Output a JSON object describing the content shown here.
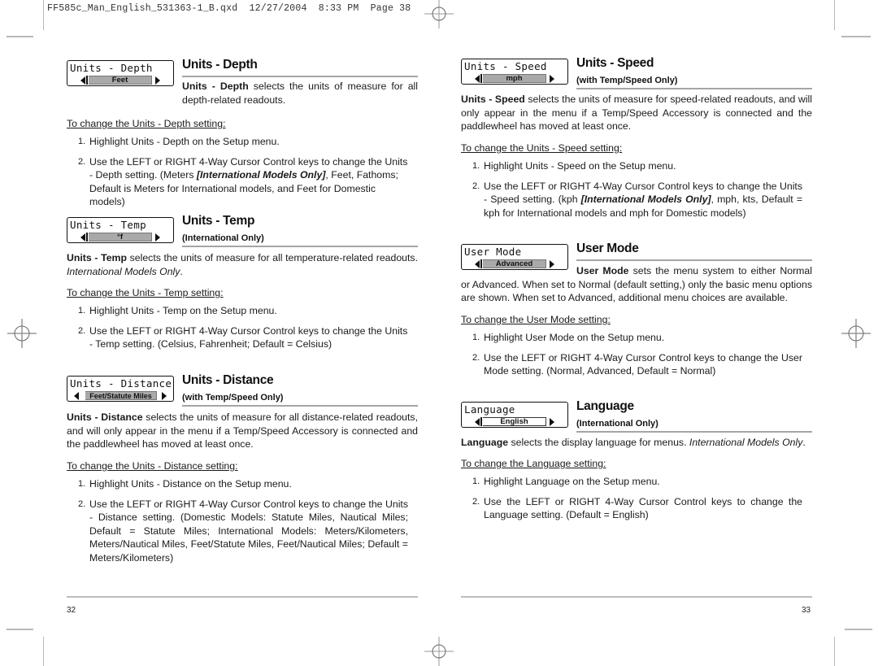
{
  "slug_line": "FF585c_Man_English_531363-1_B.qxd  12/27/2004  8:33 PM  Page 38",
  "left_page": {
    "page_number": "32",
    "sections": [
      {
        "id": "units-depth",
        "menu_title": "Units - Depth",
        "menu_value": "Feet",
        "heading": "Units - Depth",
        "subheading": "",
        "desc_bold": "Units - Depth",
        "desc_rest": " selects the units of measure for all depth-related readouts.",
        "change_label": "To change the Units - Depth setting:",
        "steps": [
          {
            "num": "1.",
            "text": "Highlight Units - Depth on the Setup menu."
          },
          {
            "num": "2.",
            "pre": "Use the LEFT or RIGHT 4-Way Cursor Control keys to change the Units - Depth setting. (Meters ",
            "em": "[International Models Only]",
            "post": ", Feet, Fathoms; Default is Meters for International models, and Feet for Domestic models)"
          }
        ]
      },
      {
        "id": "units-temp",
        "menu_title": "Units - Temp",
        "menu_value": "°f",
        "heading": "Units - Temp",
        "subheading": "(International Only)",
        "desc_bold": "Units - Temp",
        "desc_rest": " selects the units of measure for all temperature-related readouts. ",
        "desc_italic": "International Models Only",
        "desc_end": ".",
        "change_label": "To change the Units - Temp setting:",
        "steps": [
          {
            "num": "1.",
            "text": "Highlight Units - Temp on the Setup menu."
          },
          {
            "num": "2.",
            "text": "Use the LEFT or RIGHT 4-Way Cursor Control keys to change the Units - Temp setting. (Celsius, Fahrenheit; Default = Celsius)"
          }
        ]
      },
      {
        "id": "units-distance",
        "menu_title": "Units - Distance",
        "menu_value": "Feet/Statute Miles",
        "heading": "Units - Distance",
        "subheading": "(with Temp/Speed Only)",
        "desc_bold": "Units - Distance",
        "desc_rest": " selects the units of measure for all distance-related readouts, and will only appear in the menu if a Temp/Speed Accessory is connected and the paddlewheel has moved at least once.",
        "change_label": "To change the Units - Distance setting:",
        "steps": [
          {
            "num": "1.",
            "text": "Highlight Units - Distance on the Setup menu."
          },
          {
            "num": "2.",
            "text": "Use the LEFT or RIGHT 4-Way Cursor Control keys to change the Units - Distance setting. (Domestic Models: Statute Miles, Nautical Miles; Default = Statute Miles; International Models: Meters/Kilometers, Meters/Nautical Miles, Feet/Statute Miles, Feet/Nautical Miles; Default = Meters/Kilometers)"
          }
        ]
      }
    ]
  },
  "right_page": {
    "page_number": "33",
    "sections": [
      {
        "id": "units-speed",
        "menu_title": "Units - Speed",
        "menu_value": "mph",
        "heading": "Units - Speed",
        "subheading": "(with Temp/Speed Only)",
        "desc_bold": "Units - Speed",
        "desc_rest": " selects the units of measure for speed-related readouts, and will only appear in the menu if a Temp/Speed Accessory is connected and the paddlewheel has moved at least once.",
        "change_label": "To change the Units - Speed setting:",
        "steps": [
          {
            "num": "1.",
            "text": "Highlight Units - Speed on the Setup menu."
          },
          {
            "num": "2.",
            "pre": "Use the LEFT or RIGHT 4-Way Cursor Control keys to change the Units - Speed setting. (kph ",
            "em": "[International Models Only]",
            "post": ", mph, kts, Default = kph for International models and mph for Domestic models)"
          }
        ]
      },
      {
        "id": "user-mode",
        "menu_title": "User Mode",
        "menu_value": "Advanced",
        "heading": "User Mode",
        "subheading": "",
        "desc_bold": "User Mode",
        "desc_rest": " sets the menu system to either Normal or Advanced. When set to Normal (default setting,) only the basic menu options are shown.  When set to Advanced, additional menu choices are available.",
        "change_label": "To change the User Mode setting:",
        "steps": [
          {
            "num": "1.",
            "text": "Highlight User Mode on the Setup menu."
          },
          {
            "num": "2.",
            "text": "Use the LEFT or RIGHT 4-Way Cursor Control keys to change the User Mode setting. (Normal, Advanced, Default = Normal)"
          }
        ]
      },
      {
        "id": "language",
        "menu_title": "Language",
        "menu_value": "English",
        "heading": "Language",
        "subheading": "(International Only)",
        "desc_bold": "Language",
        "desc_rest": " selects the display language for menus. ",
        "desc_italic": "International Models Only",
        "desc_end": ".",
        "change_label": "To change the Language setting:",
        "steps": [
          {
            "num": "1.",
            "text": "Highlight Language on the Setup menu."
          },
          {
            "num": "2.",
            "text": "Use the LEFT or RIGHT 4-Way Cursor Control keys to change the Language setting. (Default = English)"
          }
        ]
      }
    ]
  }
}
